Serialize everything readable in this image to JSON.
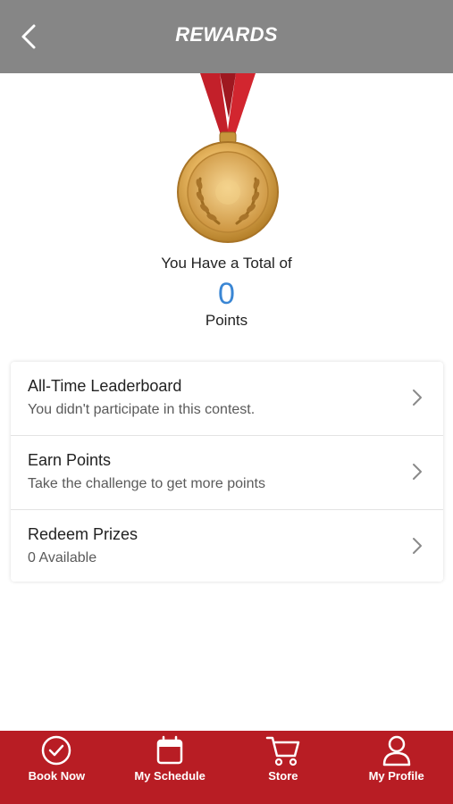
{
  "header": {
    "title": "REWARDS",
    "back_icon": "chevron-left-icon"
  },
  "summary": {
    "total_label": "You Have a Total of",
    "points_value": "0",
    "points_label": "Points",
    "medal_icon": "gold-medal-icon"
  },
  "menu": [
    {
      "title": "All-Time Leaderboard",
      "subtitle": "You didn't participate in this contest."
    },
    {
      "title": "Earn Points",
      "subtitle": "Take the challenge to get more points"
    },
    {
      "title": "Redeem Prizes",
      "subtitle": "0 Available"
    }
  ],
  "tabbar": {
    "items": [
      {
        "label": "Book Now",
        "icon": "check-circle-icon"
      },
      {
        "label": "My Schedule",
        "icon": "calendar-icon"
      },
      {
        "label": "Store",
        "icon": "cart-icon"
      },
      {
        "label": "My Profile",
        "icon": "user-icon"
      }
    ]
  },
  "colors": {
    "header_bg": "#868686",
    "accent_red": "#b81d24",
    "points_blue": "#3a86d4",
    "gold": "#d9a441"
  }
}
